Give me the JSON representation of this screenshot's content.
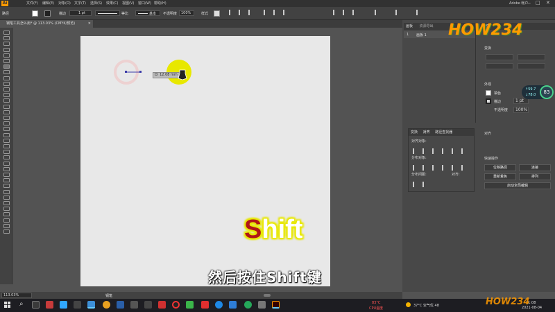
{
  "app": {
    "logo": "Ai",
    "menu": [
      "文件(F)",
      "编辑(E)",
      "对象(O)",
      "文字(T)",
      "选择(S)",
      "效果(C)",
      "视图(V)",
      "窗口(W)",
      "帮助(H)"
    ],
    "window_controls": [
      "—",
      "□",
      "✕"
    ],
    "right_user": "Adobe 帐户"
  },
  "control_bar": {
    "left_label": "路径",
    "stroke_label": "描边",
    "stroke_value": "1 pt",
    "uniform_label": "等比",
    "basic_label": "基本",
    "opacity_label": "不透明度",
    "opacity_value": "100%",
    "style_label": "样式"
  },
  "document": {
    "tab_title": "钢笔工具怎么用* @ 113.03% (CMYK/预览)",
    "tab_close": "✕"
  },
  "canvas": {
    "measure_label": "D: 12.08 mm",
    "overlay_word": "Shift",
    "overlay_word_first": "S",
    "overlay_word_rest": "hift"
  },
  "subtitle": "然后按住Shift键",
  "status_bar": {
    "zoom": "113.03%",
    "tool_name": "钢笔"
  },
  "right_panel": {
    "artboards_tab": "画板",
    "asset_export_tab": "资源导出",
    "artboard_row_num": "1",
    "artboard_row_name": "画板 1",
    "properties_title": "属性",
    "transform_title": "变换",
    "appearance_title": "外观",
    "fill_label": "填色",
    "stroke_label": "描边",
    "stroke_value": "1 pt",
    "opacity_label": "不透明度",
    "opacity_value": "100%",
    "align_title": "对齐",
    "quick_actions_title": "快速操作",
    "btn_offset_path": "位移路径",
    "btn_join": "连接",
    "btn_recolor": "重新着色",
    "btn_arrange": "排列",
    "btn_global_edit": "启动全局编辑",
    "align_tabs": [
      "变换",
      "对齐",
      "路径查找器"
    ],
    "align_objects_label": "对齐对象:",
    "distribute_objects_label": "分布对象:",
    "distribute_spacing_label": "分布间距:",
    "align_to_label": "对齐:"
  },
  "perf_widget": {
    "percent": "83",
    "up": "↑59.7",
    "down": "↓78.0"
  },
  "watermark": "HOW234",
  "taskbar": {
    "cpu_temp": "83°C",
    "cpu_label": "CPU温度",
    "weather": "37°C 空气优 48",
    "time": "11:08",
    "date": "2021-08-04"
  },
  "colors": {
    "accent_yellow": "#e8e800",
    "shift_red": "#b01717",
    "ai_orange": "#ff9a00",
    "panel_bg": "#484848"
  }
}
